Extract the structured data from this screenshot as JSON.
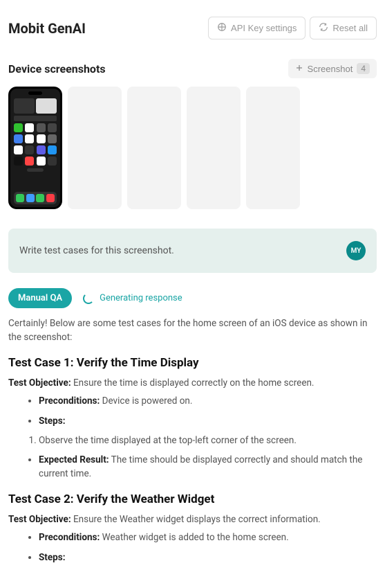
{
  "header": {
    "title": "Mobit GenAI",
    "apiKeyBtn": "API Key settings",
    "resetBtn": "Reset all"
  },
  "screenshots": {
    "sectionTitle": "Device screenshots",
    "addBtn": "Screenshot",
    "remainingCount": "4"
  },
  "prompt": {
    "text": "Write test cases for this screenshot.",
    "avatarInitials": "MY"
  },
  "status": {
    "badge": "Manual QA",
    "generating": "Generating response"
  },
  "response": {
    "intro": "Certainly! Below are some test cases for the home screen of an iOS device as shown in the screenshot:",
    "tc1": {
      "title": "Test Case 1: Verify the Time Display",
      "objectiveLabel": "Test Objective:",
      "objective": " Ensure the time is displayed correctly on the home screen.",
      "preconditionsLabel": "Preconditions:",
      "preconditions": " Device is powered on.",
      "stepsLabel": "Steps:",
      "step1": "Observe the time displayed at the top-left corner of the screen.",
      "expectedLabel": "Expected Result:",
      "expected": " The time should be displayed correctly and should match the current time."
    },
    "tc2": {
      "title": "Test Case 2: Verify the Weather Widget",
      "objectiveLabel": "Test Objective:",
      "objective": " Ensure the Weather widget displays the correct information.",
      "preconditionsLabel": "Preconditions:",
      "preconditions": " Weather widget is added to the home screen.",
      "stepsLabel": "Steps:"
    }
  }
}
